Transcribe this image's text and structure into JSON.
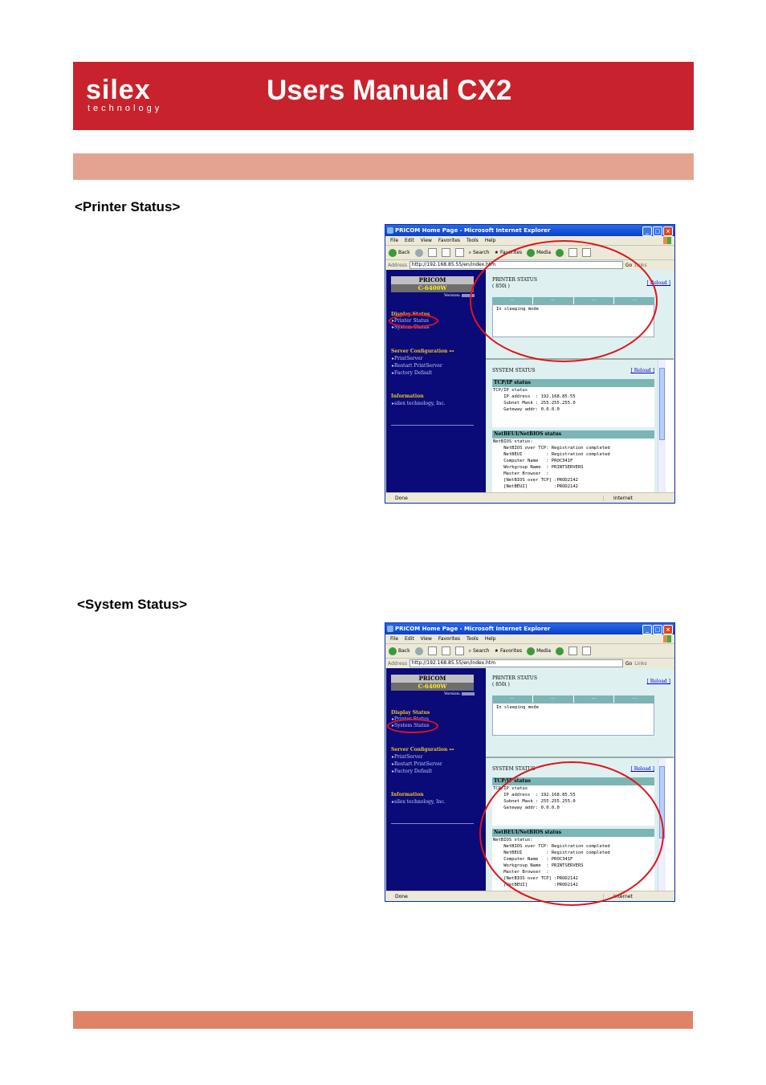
{
  "header": {
    "logo_main": "silex",
    "logo_sub": "technology",
    "title": "Users Manual CX2"
  },
  "sections": [
    {
      "title": "<Printer Status>"
    },
    {
      "title": "<System Status>"
    }
  ],
  "browser": {
    "window_title": "PRICOM Home Page - Microsoft Internet Explorer",
    "menu": [
      "File",
      "Edit",
      "View",
      "Favorites",
      "Tools",
      "Help"
    ],
    "toolbar": {
      "back": "Back",
      "search": "Search",
      "favorites": "Favorites",
      "media": "Media"
    },
    "address_label": "Address",
    "address_url": "http://192.168.85.55/en/index.htm",
    "go": "Go",
    "links": "Links",
    "status_done": "Done",
    "status_zone": "Internet"
  },
  "page": {
    "brand": "PRICOM",
    "model": "C-6400W",
    "version_label": "Version:",
    "nav": {
      "display_status": "Display Status",
      "printer_status": "Printer Status",
      "system_status": "System Status",
      "server_config": "Server Configuration",
      "print_server": "PrintServer",
      "restart": "Restart PrintServer",
      "factory_default": "Factory Default",
      "information": "Information",
      "silex": "silex technology, Inc."
    },
    "printer_status": {
      "title": "PRINTER STATUS",
      "model": "( 850i )",
      "reload": "[ Reload ]",
      "grid": [
        "---",
        "---",
        "---",
        "---"
      ],
      "message": "In sleeping mode"
    },
    "system_status": {
      "title": "SYSTEM STATUS",
      "reload": "[ Reload ]",
      "tcpip_header": "TCP/IP status",
      "tcpip_lines": "TCP/IP status\n    IP address  : 192.168.85.55\n    Subnet Mask : 255.255.255.0\n    Gateway addr: 0.0.0.0",
      "netbeui_header": "NetBEUI/NetBIOS status",
      "netbeui_lines": "NetBIOS status:\n    NetBIOS over TCP: Registration completed\n    NetBEUI         : Registration completed\n    Computer Name   : PROC341F\n    Workgroup Name  : PRINTSERVERS\n    Master Browser  :\n    [NetBIOS over TCP] :PROD2142\n    [NetBEUI]          :PROD2142"
    }
  }
}
